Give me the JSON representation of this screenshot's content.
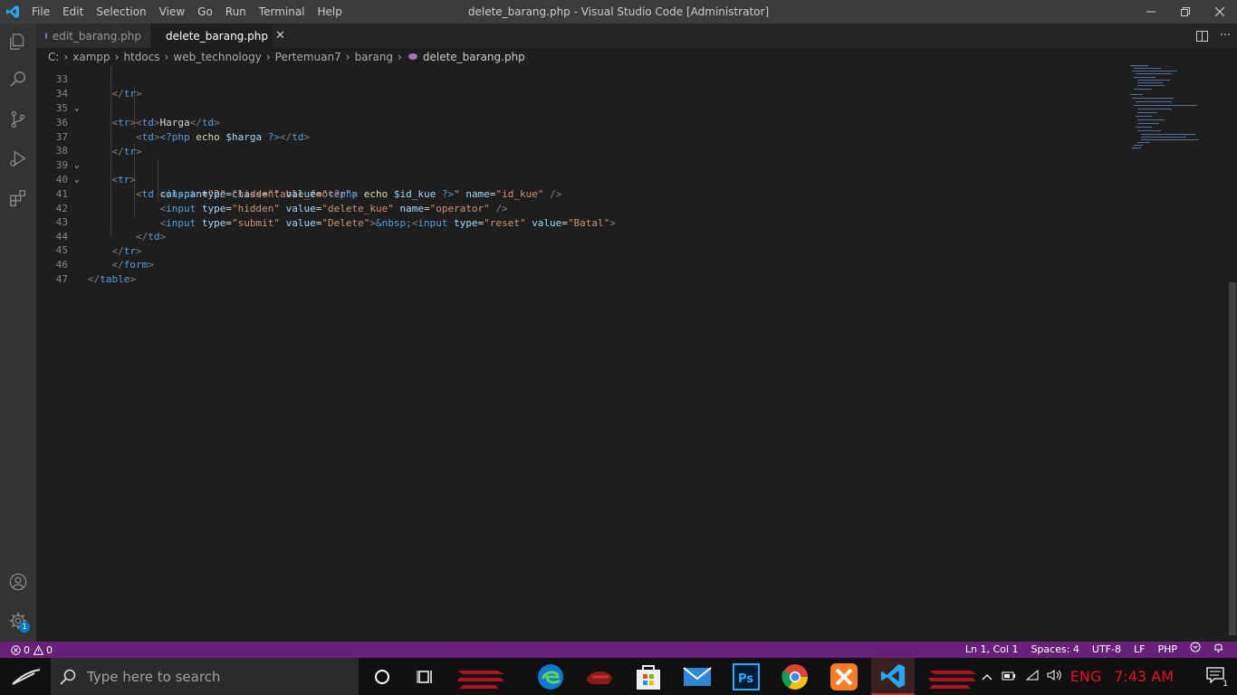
{
  "window": {
    "title": "delete_barang.php - Visual Studio Code [Administrator]",
    "menu": [
      "File",
      "Edit",
      "Selection",
      "View",
      "Go",
      "Run",
      "Terminal",
      "Help"
    ]
  },
  "tabs": [
    {
      "label": "edit_barang.php",
      "active": false
    },
    {
      "label": "delete_barang.php",
      "active": true
    }
  ],
  "breadcrumb": [
    "C:",
    "xampp",
    "htdocs",
    "web_technology",
    "Pertemuan7",
    "barang",
    "delete_barang.php"
  ],
  "line_numbers": [
    "34",
    "35",
    "36",
    "37",
    "38",
    "39",
    "40",
    "41",
    "42",
    "43",
    "44",
    "45",
    "46",
    "47"
  ],
  "code": {
    "l35": {
      "text": "Harga"
    },
    "l36": {
      "php_open": "<?php",
      "echo": "echo",
      "var": "$harga",
      "php_close": "?>"
    },
    "l39": {
      "attr1": "colspan",
      "val1": "\"2\"",
      "attr2": "class",
      "val2": "\"table_footer\""
    },
    "l40": {
      "type": "\"hidden\"",
      "value_open": "\"",
      "php_open": "<?php",
      "echo": "echo",
      "var": "$id_kue",
      "php_close": "?>",
      "value_close": "\"",
      "name": "\"id_kue\""
    },
    "l41": {
      "type": "\"hidden\"",
      "value": "\"delete_kue\"",
      "name": "\"operator\""
    },
    "l42": {
      "type": "\"submit\"",
      "value": "\"Delete\"",
      "entity": "&nbsp;",
      "type2": "\"reset\"",
      "value2": "\"Batal\""
    }
  },
  "statusbar": {
    "errors": "0",
    "warnings": "0",
    "position": "Ln 1, Col 1",
    "spaces": "Spaces: 4",
    "encoding": "UTF-8",
    "eol": "LF",
    "language": "PHP"
  },
  "activity": {
    "settings_badge": "1"
  },
  "taskbar": {
    "search_placeholder": "Type here to search",
    "lang": "ENG",
    "time": "7:43 AM",
    "notification_count": "1"
  },
  "colors": {
    "statusbar": "#68217a",
    "editor_bg": "#1e1e1e",
    "tag": "#569cd6",
    "attribute": "#9cdcfe",
    "string": "#ce9178"
  }
}
